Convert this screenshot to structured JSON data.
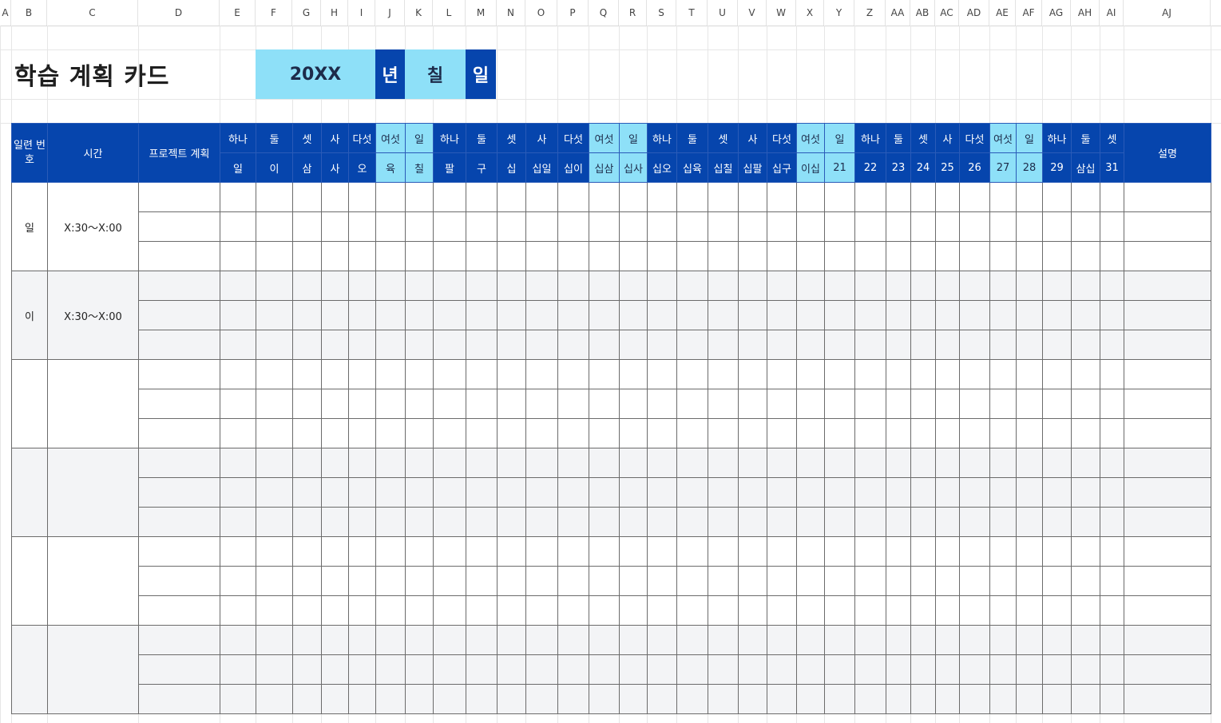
{
  "columns": [
    "A",
    "B",
    "C",
    "D",
    "E",
    "F",
    "G",
    "H",
    "I",
    "J",
    "K",
    "L",
    "M",
    "N",
    "O",
    "P",
    "Q",
    "R",
    "S",
    "T",
    "U",
    "V",
    "W",
    "X",
    "Y",
    "Z",
    "AA",
    "AB",
    "AC",
    "AD",
    "AE",
    "AF",
    "AG",
    "AH",
    "AI",
    "AJ"
  ],
  "title": "학습 계획 카드",
  "date": {
    "year": "20XX",
    "year_unit": "년",
    "month": "칠",
    "day_unit": "일"
  },
  "header": {
    "serial": "일련 번호",
    "time": "시간",
    "project": "프로젝트 계획",
    "note": "설명",
    "weekdays": [
      "하나",
      "둘",
      "셋",
      "사",
      "다섯",
      "여섯",
      "일",
      "하나",
      "둘",
      "셋",
      "사",
      "다섯",
      "여섯",
      "일",
      "하나",
      "둘",
      "셋",
      "사",
      "다섯",
      "여섯",
      "일",
      "하나",
      "둘",
      "셋",
      "사",
      "다섯",
      "여섯",
      "일",
      "하나",
      "둘",
      "셋"
    ],
    "days": [
      "일",
      "이",
      "삼",
      "사",
      "오",
      "육",
      "칠",
      "팔",
      "구",
      "십",
      "십일",
      "십이",
      "십삼",
      "십사",
      "십오",
      "십육",
      "십칠",
      "십팔",
      "십구",
      "이십",
      "21",
      "22",
      "23",
      "24",
      "25",
      "26",
      "27",
      "28",
      "29",
      "삼십",
      "31"
    ],
    "weekend_flags": [
      0,
      0,
      0,
      0,
      0,
      1,
      1,
      0,
      0,
      0,
      0,
      0,
      1,
      1,
      0,
      0,
      0,
      0,
      0,
      1,
      1,
      0,
      0,
      0,
      0,
      0,
      1,
      1,
      0,
      0,
      0
    ]
  },
  "groups": [
    {
      "serial": "일",
      "time": "X:30～X:00"
    },
    {
      "serial": "이",
      "time": "X:30～X:00"
    },
    {
      "serial": "",
      "time": ""
    },
    {
      "serial": "",
      "time": ""
    },
    {
      "serial": "",
      "time": ""
    },
    {
      "serial": "",
      "time": ""
    }
  ],
  "colors": {
    "dark": "#0645ad",
    "light": "#8ee0f8",
    "shade": "#f3f4f6"
  }
}
